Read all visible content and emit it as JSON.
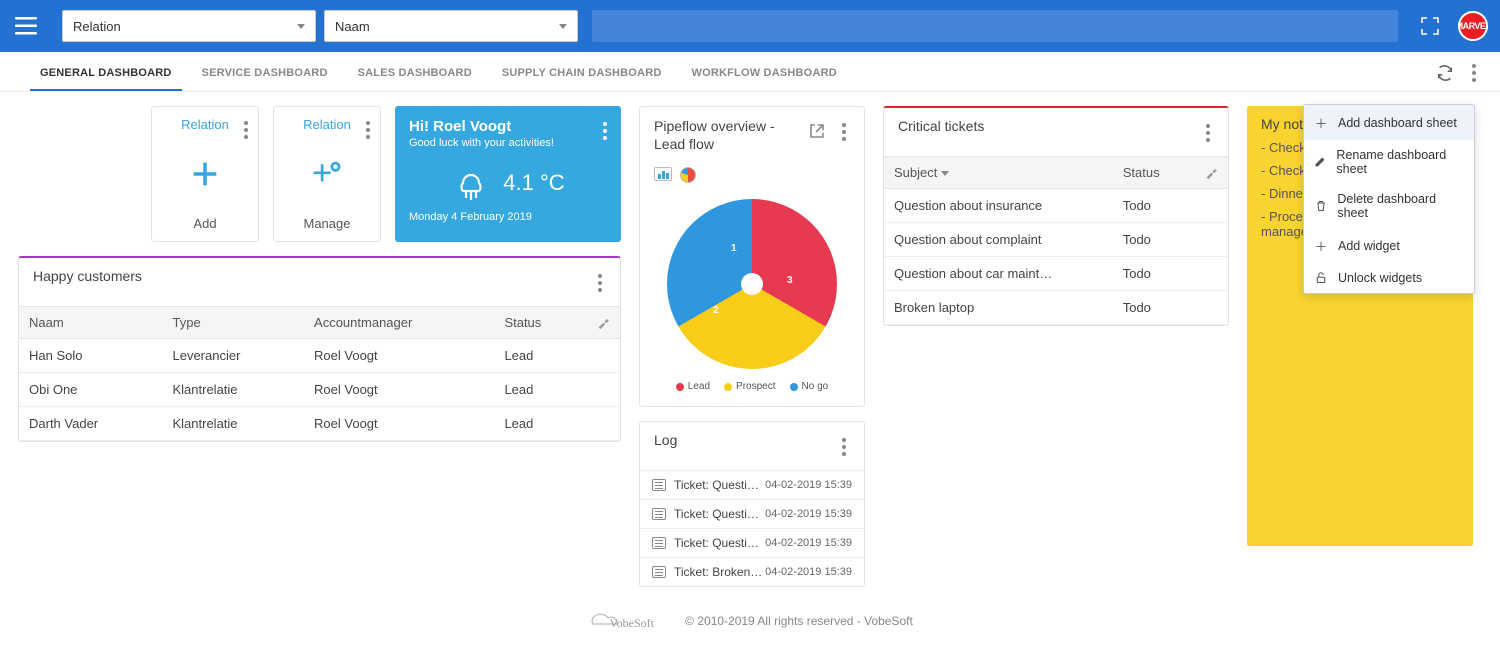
{
  "header": {
    "dropdown1": "Relation",
    "dropdown2": "Naam",
    "avatar_label": "MARVEL"
  },
  "tabs": [
    {
      "label": "GENERAL DASHBOARD",
      "active": true
    },
    {
      "label": "SERVICE DASHBOARD",
      "active": false
    },
    {
      "label": "SALES DASHBOARD",
      "active": false
    },
    {
      "label": "SUPPLY CHAIN DASHBOARD",
      "active": false
    },
    {
      "label": "WORKFLOW DASHBOARD",
      "active": false
    }
  ],
  "quickcards": {
    "add": {
      "title": "Relation",
      "action": "Add"
    },
    "manage": {
      "title": "Relation",
      "action": "Manage"
    }
  },
  "weather": {
    "greeting": "Hi! Roel Voogt",
    "subtext": "Good luck with your activities!",
    "temp": "4.1 °C",
    "date": "Monday 4 February 2019"
  },
  "happy": {
    "title": "Happy customers",
    "columns": [
      "Naam",
      "Type",
      "Accountmanager",
      "Status"
    ],
    "rows": [
      {
        "naam": "Han Solo",
        "type": "Leverancier",
        "mgr": "Roel Voogt",
        "status": "Lead"
      },
      {
        "naam": "Obi One",
        "type": "Klantrelatie",
        "mgr": "Roel Voogt",
        "status": "Lead"
      },
      {
        "naam": "Darth Vader",
        "type": "Klantrelatie",
        "mgr": "Roel Voogt",
        "status": "Lead"
      }
    ]
  },
  "pipeflow": {
    "title": "Pipeflow overview - Lead flow"
  },
  "chart_data": {
    "type": "pie",
    "title": "Pipeflow overview - Lead flow",
    "series": [
      {
        "name": "Lead",
        "value": 3,
        "color": "#e7394f"
      },
      {
        "name": "Prospect",
        "value": 2,
        "color": "#f9cc18"
      },
      {
        "name": "No go",
        "value": 1,
        "color": "#2f97dd"
      }
    ]
  },
  "log": {
    "title": "Log",
    "items": [
      {
        "label": "Ticket: Questi…",
        "time": "04-02-2019 15:39"
      },
      {
        "label": "Ticket: Questi…",
        "time": "04-02-2019 15:39"
      },
      {
        "label": "Ticket: Questi…",
        "time": "04-02-2019 15:39"
      },
      {
        "label": "Ticket: Broken…",
        "time": "04-02-2019 15:39"
      }
    ]
  },
  "critical": {
    "title": "Critical tickets",
    "columns": [
      "Subject",
      "Status"
    ],
    "rows": [
      {
        "subject": "Question about insurance",
        "status": "Todo"
      },
      {
        "subject": "Question about complaint",
        "status": "Todo"
      },
      {
        "subject": "Question about car maint…",
        "status": "Todo"
      },
      {
        "subject": "Broken laptop",
        "status": "Todo"
      }
    ]
  },
  "notes": {
    "title": "My notes",
    "items": [
      "- Check",
      "- Check",
      "- Dinner tonight!",
      "- Process optimization service management department"
    ]
  },
  "ctxmenu": {
    "items": [
      {
        "icon": "plus",
        "label": "Add dashboard sheet",
        "hl": true
      },
      {
        "icon": "pencil",
        "label": "Rename dashboard sheet"
      },
      {
        "icon": "trash",
        "label": "Delete dashboard sheet"
      },
      {
        "icon": "plus",
        "label": "Add widget"
      },
      {
        "icon": "unlock",
        "label": "Unlock widgets"
      }
    ]
  },
  "footer": {
    "brand": "VobeSoft",
    "copyright": "© 2010-2019 All rights reserved - VobeSoft"
  }
}
